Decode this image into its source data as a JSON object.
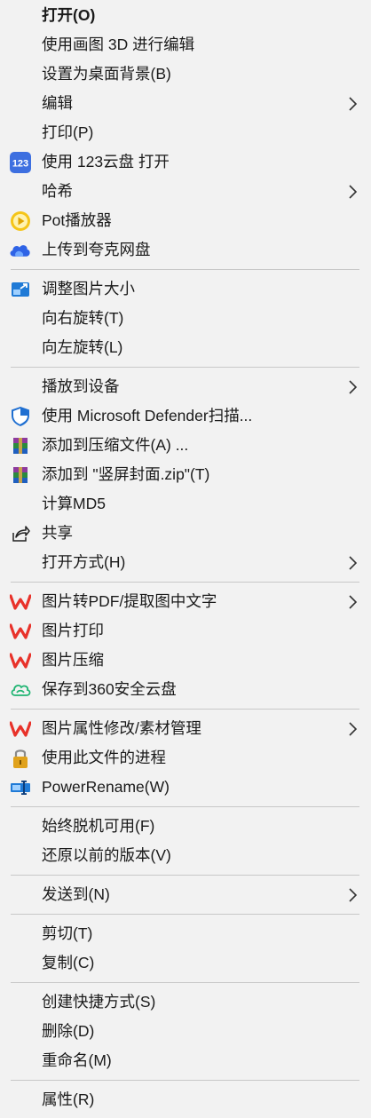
{
  "menu": {
    "items": [
      {
        "label": "打开(O)"
      },
      {
        "label": "使用画图 3D 进行编辑"
      },
      {
        "label": "设置为桌面背景(B)"
      },
      {
        "label": "编辑"
      },
      {
        "label": "打印(P)"
      },
      {
        "label": "使用 123云盘 打开",
        "icon_text": "123"
      },
      {
        "label": "哈希"
      },
      {
        "label": "Pot播放器"
      },
      {
        "label": "上传到夸克网盘"
      },
      {
        "label": "调整图片大小"
      },
      {
        "label": "向右旋转(T)"
      },
      {
        "label": "向左旋转(L)"
      },
      {
        "label": "播放到设备"
      },
      {
        "label": "使用 Microsoft Defender扫描..."
      },
      {
        "label": "添加到压缩文件(A) ..."
      },
      {
        "label": "添加到 \"竖屏封面.zip\"(T)"
      },
      {
        "label": "计算MD5"
      },
      {
        "label": "共享"
      },
      {
        "label": "打开方式(H)"
      },
      {
        "label": "图片转PDF/提取图中文字"
      },
      {
        "label": "图片打印"
      },
      {
        "label": "图片压缩"
      },
      {
        "label": "保存到360安全云盘"
      },
      {
        "label": "图片属性修改/素材管理"
      },
      {
        "label": "使用此文件的进程"
      },
      {
        "label": "PowerRename(W)"
      },
      {
        "label": "始终脱机可用(F)"
      },
      {
        "label": "还原以前的版本(V)"
      },
      {
        "label": "发送到(N)"
      },
      {
        "label": "剪切(T)"
      },
      {
        "label": "复制(C)"
      },
      {
        "label": "创建快捷方式(S)"
      },
      {
        "label": "删除(D)"
      },
      {
        "label": "重命名(M)"
      },
      {
        "label": "属性(R)"
      }
    ]
  },
  "colors": {
    "background": "#f2f2f2",
    "separator": "#c8c8c8",
    "wps_red": "#e8322a",
    "cloud123_blue": "#3d6fe0",
    "pot_yellow": "#f5c518",
    "defender_blue": "#1f6fd1"
  },
  "icons": {
    "cloud123": "123-cloud-icon",
    "pot": "potplayer-icon",
    "quark": "quark-cloud-icon",
    "resize": "resize-image-icon",
    "defender": "defender-shield-icon",
    "winrar": "winrar-icon",
    "share": "share-icon",
    "wps": "wps-icon",
    "cloud360": "360-cloud-icon",
    "lock": "lock-icon",
    "powerrename": "powerrename-icon"
  }
}
